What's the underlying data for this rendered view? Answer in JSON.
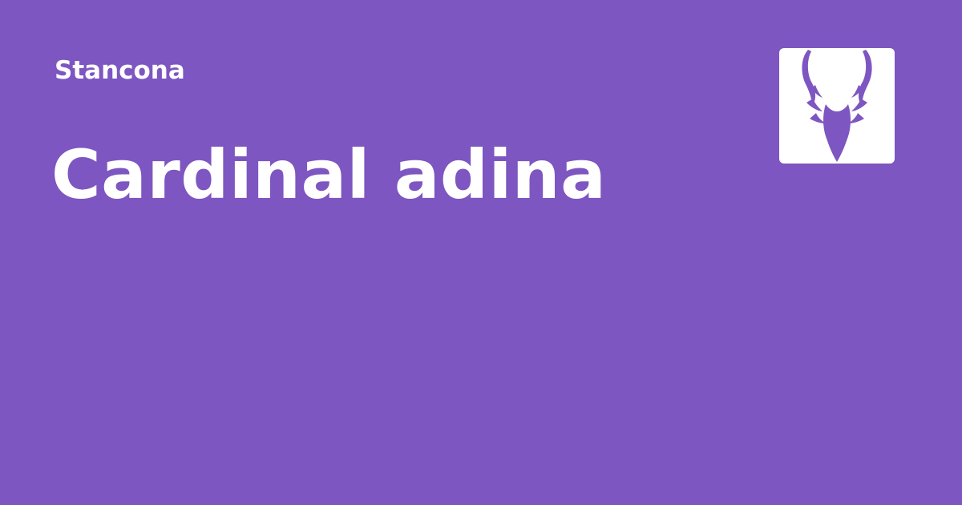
{
  "colors": {
    "background": "#7d56c1",
    "text": "#ffffff",
    "logo_tile": "#ffffff",
    "logo_mark": "#7d56c1"
  },
  "header": {
    "site_name": "Stancona"
  },
  "main": {
    "title": "Cardinal adina"
  },
  "logo": {
    "icon": "dragon-head-icon"
  }
}
